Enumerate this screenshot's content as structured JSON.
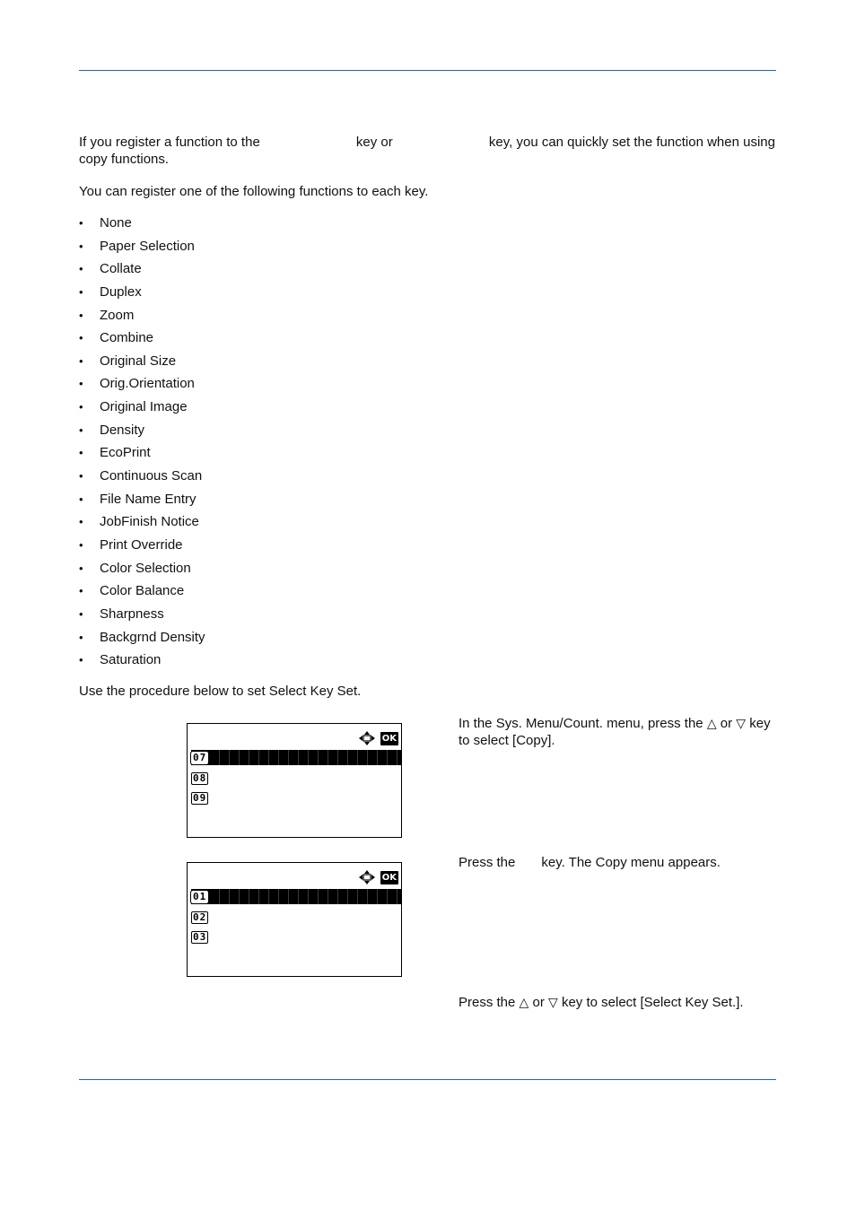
{
  "intro": {
    "part1": "If you register a function to the",
    "part2": "key or",
    "part3": "key, you can quickly set the function when using",
    "line2": "copy functions."
  },
  "register_text": "You can register one of the following functions to each key.",
  "functions": [
    "None",
    "Paper Selection",
    "Collate",
    "Duplex",
    "Zoom",
    "Combine",
    "Original Size",
    "Orig.Orientation",
    "Original Image",
    "Density",
    "EcoPrint",
    "Continuous Scan",
    "File Name Entry",
    "JobFinish Notice",
    "Print Override",
    "Color Selection",
    "Color Balance",
    "Sharpness",
    "Backgrnd Density",
    "Saturation"
  ],
  "bullet": "•",
  "procedure_text": "Use the procedure below to set Select Key Set.",
  "screens": [
    {
      "ok_label": "OK",
      "nav_icon": "four-way-arrow-icon",
      "rows": [
        {
          "num": "07",
          "label": "",
          "selected": true
        },
        {
          "num": "08",
          "label": "",
          "selected": false
        },
        {
          "num": "09",
          "label": "",
          "selected": false
        }
      ]
    },
    {
      "ok_label": "OK",
      "nav_icon": "four-way-arrow-icon",
      "rows": [
        {
          "num": "01",
          "label": "",
          "selected": true
        },
        {
          "num": "02",
          "label": "",
          "selected": false
        },
        {
          "num": "03",
          "label": "",
          "selected": false
        }
      ]
    }
  ],
  "steps": {
    "s1_a": "In the Sys. Menu/Count. menu, press the",
    "s1_or": "or",
    "s1_b": "key to select [Copy].",
    "s2_a": "Press the",
    "s2_b": "key. The Copy menu appears.",
    "s3_a": "Press the",
    "s3_or": "or",
    "s3_b": "key to select [Select Key Set.]."
  },
  "symbols": {
    "up": "△",
    "down": "▽"
  },
  "colors": {
    "rule": "#1f5fc8"
  }
}
